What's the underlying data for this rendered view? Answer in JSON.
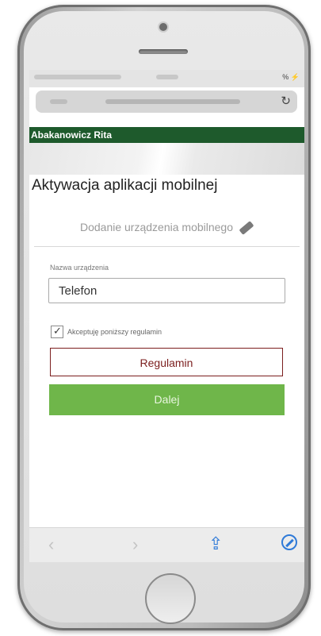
{
  "status_bar": {
    "battery": "% "
  },
  "browser": {
    "reload_label": "↻"
  },
  "header": {
    "user_name": "Abakanowicz Rita"
  },
  "page": {
    "title": "Aktywacja aplikacji mobilnej",
    "step": "Dodanie urządzenia mobilnego"
  },
  "form": {
    "device_name_label": "Nazwa urządzenia",
    "device_name_value": "Telefon",
    "accept_terms_label": "Akceptuję poniższy regulamin",
    "accept_terms_checked": true,
    "rules_button": "Regulamin",
    "next_button": "Dalej"
  },
  "toolbar": {
    "back": "‹",
    "forward": "›",
    "share": "⇪"
  },
  "colors": {
    "header_bg": "#1e5a2c",
    "rules_border": "#7b1e1e",
    "next_bg": "#6fb64a",
    "ios_blue": "#2f7ad8"
  }
}
